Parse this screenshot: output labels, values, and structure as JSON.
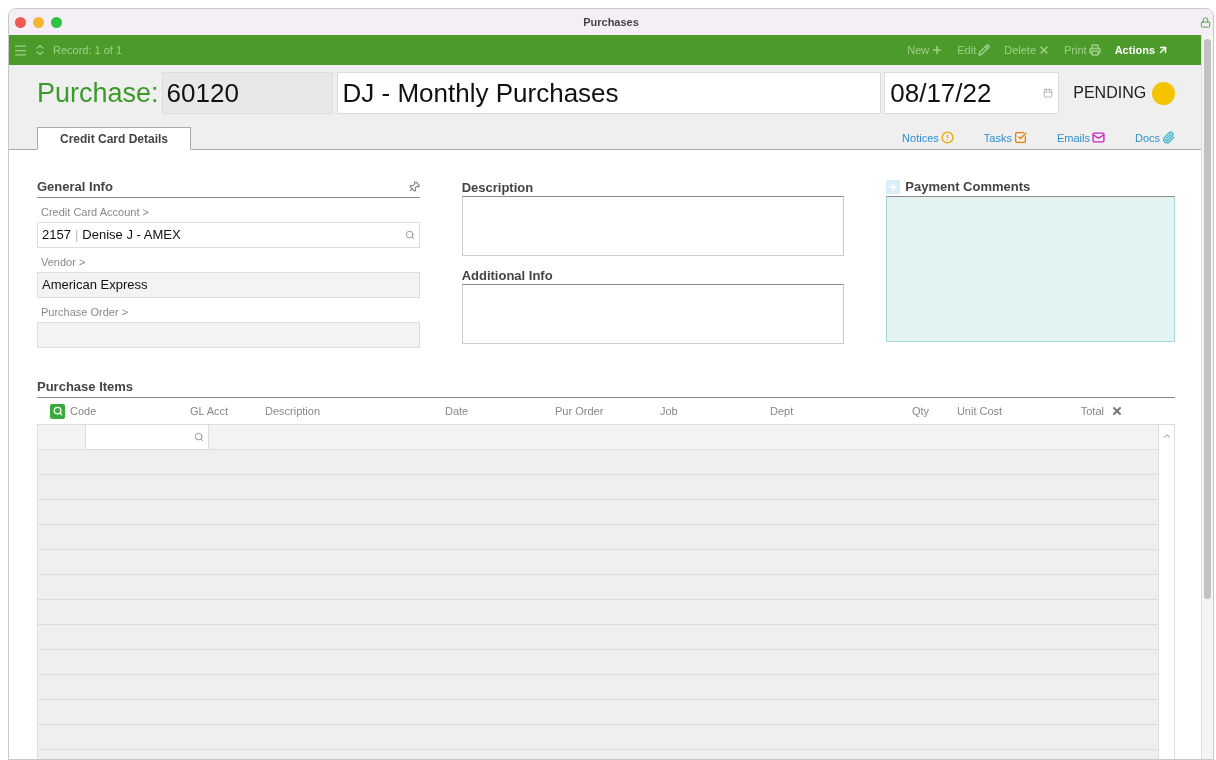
{
  "window": {
    "title": "Purchases"
  },
  "toolbar": {
    "record": "Record: 1 of 1",
    "actions": [
      {
        "label": "New",
        "kind": "plus",
        "disabled": true
      },
      {
        "label": "Edit",
        "kind": "pencil",
        "disabled": true
      },
      {
        "label": "Delete",
        "kind": "x",
        "disabled": true
      },
      {
        "label": "Print",
        "kind": "printer",
        "disabled": true
      },
      {
        "label": "Actions",
        "kind": "arrow",
        "disabled": false
      }
    ]
  },
  "header": {
    "label": "Purchase:",
    "number": "60120",
    "name": "DJ - Monthly Purchases",
    "date": "08/17/22",
    "status": "PENDING"
  },
  "tabs": [
    {
      "label": "Credit Card Details",
      "selected": true
    }
  ],
  "links": [
    {
      "label": "Notices",
      "kind": "notice"
    },
    {
      "label": "Tasks",
      "kind": "task"
    },
    {
      "label": "Emails",
      "kind": "email"
    },
    {
      "label": "Docs",
      "kind": "clip"
    }
  ],
  "general_info": {
    "title": "General Info",
    "fields": [
      {
        "label": "Credit Card Account >",
        "value": "2157",
        "separator": "|",
        "value_2": "Denise J - AMEX",
        "kind": "lookup"
      },
      {
        "label": "Vendor >",
        "value": "American Express",
        "kind": "readonly"
      },
      {
        "label": "Purchase Order >",
        "kind": "readonly"
      }
    ]
  },
  "description": {
    "title": "Description"
  },
  "additional_info": {
    "title": "Additional Info"
  },
  "payment_comments": {
    "title": "Payment Comments"
  },
  "purchase_items": {
    "title": "Purchase Items",
    "columns": [
      "Code",
      "GL Acct",
      "Description",
      "Date",
      "Pur Order",
      "Job",
      "Dept",
      "Qty",
      "Unit Cost",
      "Total"
    ]
  }
}
